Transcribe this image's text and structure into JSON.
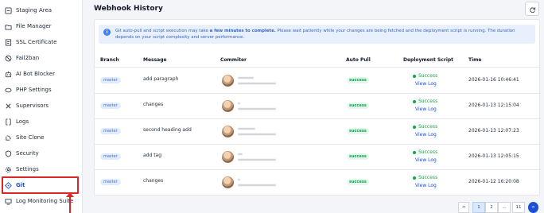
{
  "sidebar": {
    "items": [
      {
        "label": "Staging Area",
        "icon": "staging-icon"
      },
      {
        "label": "File Manager",
        "icon": "folder-icon"
      },
      {
        "label": "SSL Certificate",
        "icon": "certificate-icon"
      },
      {
        "label": "Fail2ban",
        "icon": "ban-icon"
      },
      {
        "label": "AI Bot Blocker",
        "icon": "bot-icon"
      },
      {
        "label": "PHP Settings",
        "icon": "php-icon"
      },
      {
        "label": "Supervisors",
        "icon": "supervisor-icon"
      },
      {
        "label": "Logs",
        "icon": "logs-icon"
      },
      {
        "label": "Site Clone",
        "icon": "clone-icon"
      },
      {
        "label": "Security",
        "icon": "shield-icon"
      },
      {
        "label": "Settings",
        "icon": "gear-icon"
      },
      {
        "label": "Git",
        "icon": "git-icon"
      },
      {
        "label": "Log Monitoring Suite",
        "icon": "monitor-icon"
      }
    ],
    "active": "Git"
  },
  "header": {
    "title": "Webhook History"
  },
  "info": {
    "text_start": "Git auto-pull and script execution may take ",
    "text_bold": "a few minutes to complete.",
    "text_end": " Please wait patiently while your changes are being fetched and the deployment script is running. The duration depends on your script complexity and server performance."
  },
  "table": {
    "headers": {
      "branch": "Branch",
      "message": "Message",
      "commiter": "Commiter",
      "auto_pull": "Auto Pull",
      "deployment_script": "Deployment Script",
      "time": "Time"
    },
    "rows": [
      {
        "branch": "master",
        "message": "add paragraph",
        "auto_pull": "success",
        "deploy_status": "Success",
        "view_log": "View Log",
        "time": "2026-01-16 10:46:41"
      },
      {
        "branch": "master",
        "message": "changes",
        "auto_pull": "success",
        "deploy_status": "Success",
        "view_log": "View Log",
        "time": "2026-01-13 12:15:04"
      },
      {
        "branch": "master",
        "message": "second heading add",
        "auto_pull": "success",
        "deploy_status": "Success",
        "view_log": "View Log",
        "time": "2026-01-13 12:07:23"
      },
      {
        "branch": "master",
        "message": "add tag",
        "auto_pull": "success",
        "deploy_status": "Success",
        "view_log": "View Log",
        "time": "2026-01-13 12:05:15"
      },
      {
        "branch": "master",
        "message": "changes",
        "auto_pull": "success",
        "deploy_status": "Success",
        "view_log": "View Log",
        "time": "2026-01-12 16:20:08"
      }
    ]
  },
  "pagination": {
    "prev": "<",
    "pages": [
      "1",
      "2",
      "...",
      "11"
    ],
    "current": "1",
    "next": ">"
  },
  "colors": {
    "accent": "#1d4ed8",
    "success": "#16a34a",
    "highlight": "#dc2626"
  }
}
